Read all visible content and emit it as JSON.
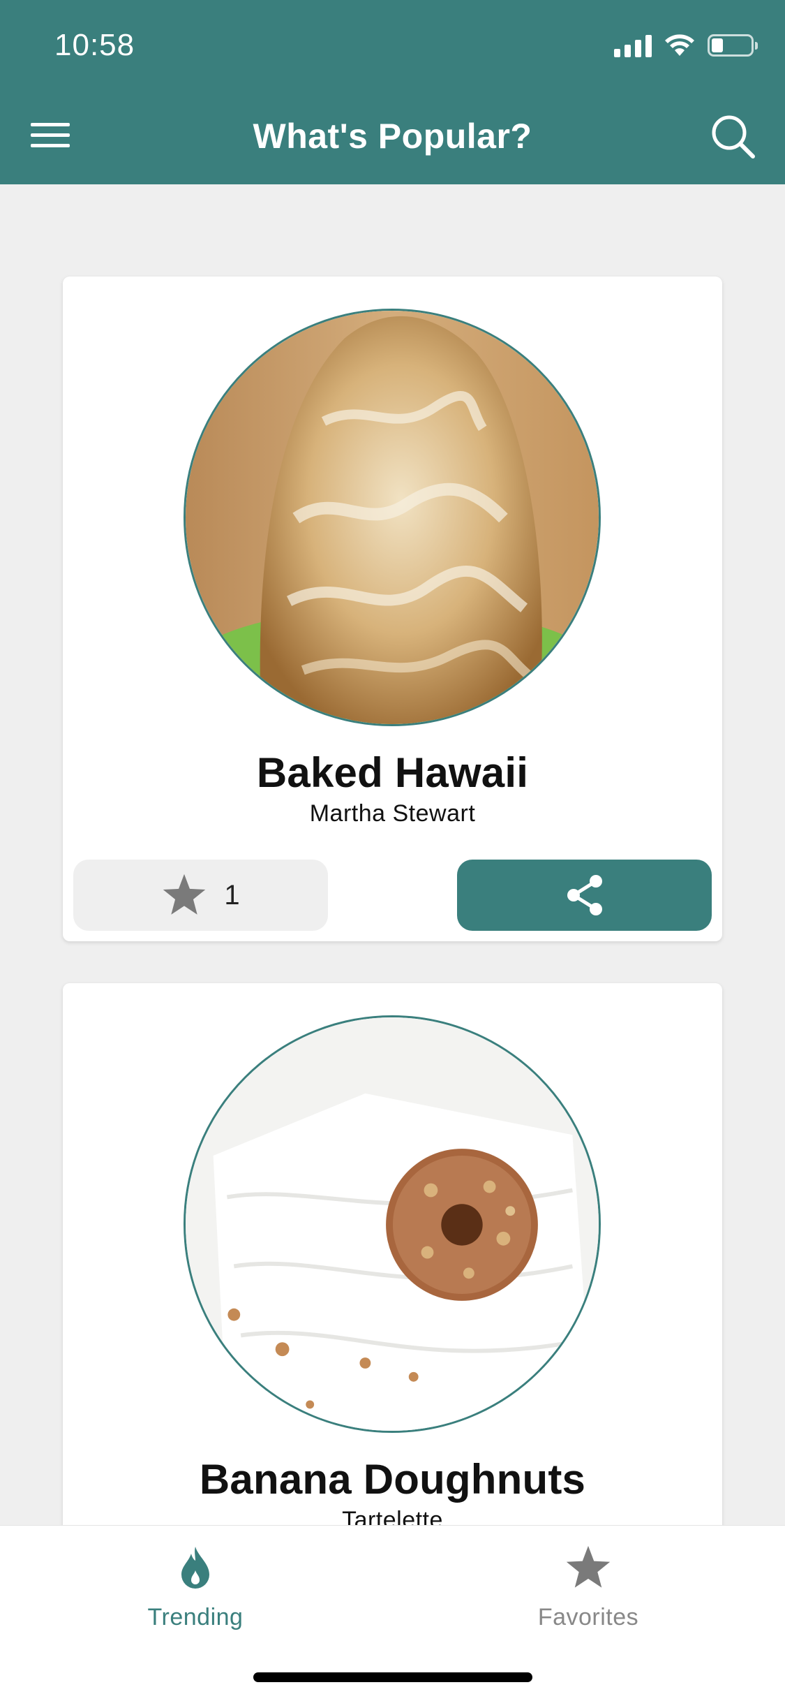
{
  "status_bar": {
    "time": "10:58"
  },
  "header": {
    "title": "What's Popular?"
  },
  "cards": [
    {
      "name": "Baked Hawaii",
      "author": "Martha Stewart",
      "favorites": "1"
    },
    {
      "name": "Banana Doughnuts",
      "author": "Tartelette"
    }
  ],
  "tabs": [
    {
      "label": "Trending",
      "icon": "flame-icon",
      "active": true
    },
    {
      "label": "Favorites",
      "icon": "star-icon",
      "active": false
    }
  ],
  "colors": {
    "brand": "#3a7f7d",
    "background": "#efefef",
    "inactive": "#888888"
  }
}
